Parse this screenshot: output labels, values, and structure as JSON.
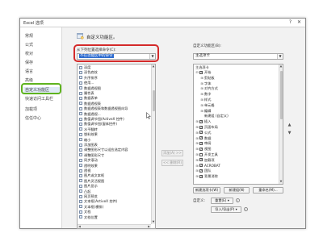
{
  "window": {
    "title": "Excel 选项",
    "help_glyph": "?",
    "close_glyph": "✕"
  },
  "sidebar": {
    "items": [
      {
        "label": "常规"
      },
      {
        "label": "公式"
      },
      {
        "label": "校对"
      },
      {
        "label": "保存"
      },
      {
        "label": "语言"
      },
      {
        "label": "高级"
      },
      {
        "label": "自定义功能区"
      },
      {
        "label": "快速访问工具栏"
      },
      {
        "label": "加载项"
      },
      {
        "label": "信任中心"
      }
    ]
  },
  "header": {
    "title": "自定义功能区。"
  },
  "left_panel": {
    "choose_label": "从下列位置选择命令(C):",
    "choose_value": "不在功能区中的命令",
    "commands": [
      "深度",
      "深色底纹",
      "升序排序",
      "使用...",
      "数据透视图",
      "属性表",
      "数据表单",
      "数据透视表",
      "数据透视表和数据透视图向导",
      "数据透视...",
      "数值调节钮(ActiveX 控件)",
      "数值调节钮(窗体控件)",
      "水平翻转",
      "塑料效果",
      "缩小",
      "添加图表",
      "调整图形尺寸以适应选定内容",
      "调整图形尺寸",
      "同步滚动",
      "透明效果",
      "透视",
      "图片或文本框",
      "图片灵活视图",
      "图片显示",
      "凸起",
      "网页预览",
      "文本框(ActiveX 控件)",
      "文本框(横排)",
      "文档",
      "文档位置"
    ]
  },
  "middle": {
    "add_label": "添加(A) >>",
    "remove_label": "<< 删除(R)"
  },
  "right_panel": {
    "customize_label": "自定义功能区(B):",
    "customize_value": "主选项卡",
    "tree_header": "主选项卡",
    "tree": [
      {
        "label": "开始",
        "level": 0,
        "expand": "⊟",
        "checked": true
      },
      {
        "label": "剪贴板",
        "level": 1,
        "expand": "⊞",
        "checked": null
      },
      {
        "label": "字体",
        "level": 1,
        "expand": "⊞",
        "checked": null
      },
      {
        "label": "对齐方式",
        "level": 1,
        "expand": "⊞",
        "checked": null
      },
      {
        "label": "数字",
        "level": 1,
        "expand": "⊞",
        "checked": null
      },
      {
        "label": "样式",
        "level": 1,
        "expand": "⊞",
        "checked": null
      },
      {
        "label": "单元格",
        "level": 1,
        "expand": "⊞",
        "checked": null
      },
      {
        "label": "编辑",
        "level": 1,
        "expand": "⊞",
        "checked": null
      },
      {
        "label": "新建组 (自定义)",
        "level": 1,
        "expand": "",
        "checked": null
      },
      {
        "label": "插入",
        "level": 0,
        "expand": "⊞",
        "checked": true
      },
      {
        "label": "页面布局",
        "level": 0,
        "expand": "⊞",
        "checked": true
      },
      {
        "label": "公式",
        "level": 0,
        "expand": "⊞",
        "checked": true
      },
      {
        "label": "数据",
        "level": 0,
        "expand": "⊞",
        "checked": true
      },
      {
        "label": "审阅",
        "level": 0,
        "expand": "⊞",
        "checked": true
      },
      {
        "label": "视图",
        "level": 0,
        "expand": "⊞",
        "checked": true
      },
      {
        "label": "开发工具",
        "level": 0,
        "expand": "⊞",
        "checked": false
      },
      {
        "label": "加载项",
        "level": 0,
        "expand": "⊞",
        "checked": true
      },
      {
        "label": "ACROBAT",
        "level": 0,
        "expand": "⊞",
        "checked": true
      },
      {
        "label": "团队",
        "level": 0,
        "expand": "⊞",
        "checked": true
      },
      {
        "label": "背景消除",
        "level": 0,
        "expand": "⊞",
        "checked": true
      }
    ],
    "new_tab_label": "新建选项卡(W)",
    "new_group_label": "新建组(N)",
    "rename_label": "重命名(M)...",
    "custom_label": "自定义:",
    "reset_label": "重置(E) ▾",
    "import_export_label": "导入/导出(P) ▾",
    "up_glyph": "▲",
    "down_glyph": "▼",
    "info_glyph": "i"
  },
  "scroll": {
    "up": "▲",
    "down": "▼",
    "left": "◀",
    "right": "▶"
  },
  "colors": {
    "highlight_red": "#d42a2a",
    "highlight_green": "#5fb31f",
    "selection_blue": "#2e6ccf"
  }
}
